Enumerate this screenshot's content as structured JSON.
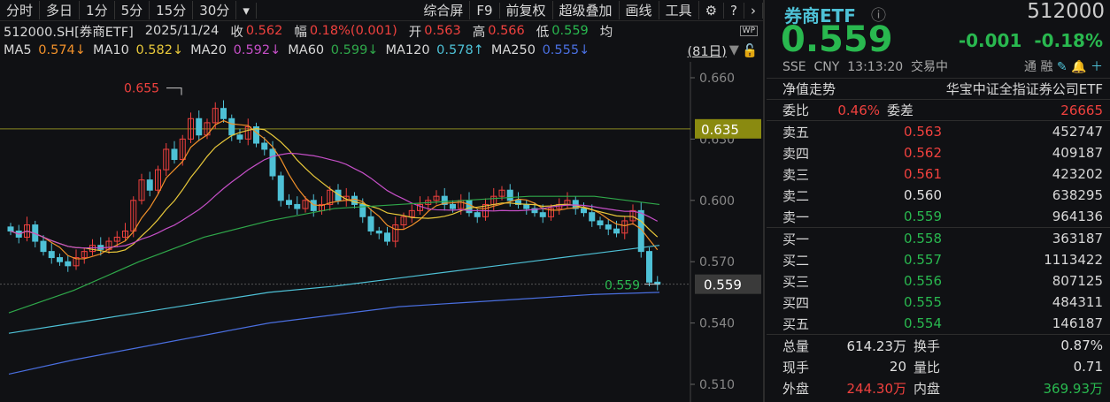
{
  "toolbar": {
    "items": [
      "分时",
      "多日",
      "1分",
      "5分",
      "15分",
      "30分",
      "▾"
    ],
    "right": [
      "综合屏",
      "F9",
      "前复权",
      "超级叠加",
      "画线",
      "工具",
      "⚙",
      "?",
      "›"
    ]
  },
  "info": {
    "code": "512000.SH[券商ETF]",
    "date": "2025/11/24",
    "close_label": "收",
    "close": "0.562",
    "amp_label": "幅",
    "amp": "0.18%(0.001)",
    "open_label": "开",
    "open": "0.563",
    "high_label": "高",
    "high": "0.566",
    "low_label": "低",
    "low": "0.559",
    "avg_label": "均"
  },
  "ma": [
    {
      "label": "MA5",
      "value": "0.574↓",
      "color": "#f0902a"
    },
    {
      "label": "MA10",
      "value": "0.582↓",
      "color": "#e8c83a"
    },
    {
      "label": "MA20",
      "value": "0.592↓",
      "color": "#c54fc7"
    },
    {
      "label": "MA60",
      "value": "0.599↓",
      "color": "#2fa84a"
    },
    {
      "label": "MA120",
      "value": "0.578↑",
      "color": "#4ec1d6"
    },
    {
      "label": "MA250",
      "value": "0.555↓",
      "color": "#4a6fe0"
    }
  ],
  "period": "(81日)",
  "chart": {
    "y_ticks": [
      "0.660",
      "0.630",
      "0.600",
      "0.570",
      "0.540",
      "0.510"
    ],
    "y_tick_values": [
      0.66,
      0.63,
      0.6,
      0.57,
      0.54,
      0.51
    ],
    "hline_label": "0.635",
    "hline_value": 0.635,
    "last_label": "0.559",
    "last_value": 0.559,
    "max_label": "0.655",
    "max_value": 0.655,
    "min_label": "0.559",
    "closes": [
      585,
      582,
      588,
      580,
      575,
      572,
      570,
      568,
      572,
      575,
      578,
      576,
      580,
      582,
      585,
      600,
      610,
      605,
      615,
      625,
      620,
      630,
      640,
      632,
      638,
      645,
      640,
      632,
      630,
      636,
      628,
      625,
      612,
      600,
      598,
      596,
      600,
      595,
      598,
      605,
      600,
      602,
      598,
      592,
      585,
      584,
      580,
      588,
      592,
      595,
      598,
      600,
      602,
      598,
      596,
      600,
      594,
      592,
      598,
      602,
      605,
      600,
      598,
      596,
      594,
      592,
      596,
      598,
      600,
      596,
      594,
      590,
      588,
      586,
      584,
      590,
      595,
      575,
      560,
      559
    ],
    "ma60": [
      545,
      556,
      570,
      582,
      590,
      596,
      598,
      600,
      602,
      602,
      598
    ],
    "ma120": [
      535,
      540,
      545,
      550,
      555,
      558,
      562,
      566,
      570,
      574,
      578
    ],
    "ma250": [
      515,
      522,
      528,
      534,
      540,
      544,
      548,
      550,
      552,
      554,
      555
    ]
  },
  "quote": {
    "name": "券商ETF",
    "code": "512000",
    "price": "0.559",
    "change": "-0.001",
    "change_pct": "-0.18%",
    "exchange": "SSE",
    "currency": "CNY",
    "time": "13:13:20",
    "status": "交易中",
    "tong": "通",
    "rong": "融",
    "nav_label": "净值走势",
    "fund_name": "华宝中证全指证券公司ETF",
    "wb_label": "委比",
    "wb": "0.46%",
    "wc_label": "委差",
    "wc": "26665"
  },
  "asks": [
    {
      "label": "卖五",
      "price": "0.563",
      "vol": "452747",
      "color": "red"
    },
    {
      "label": "卖四",
      "price": "0.562",
      "vol": "409187",
      "color": "red"
    },
    {
      "label": "卖三",
      "price": "0.561",
      "vol": "423202",
      "color": "red"
    },
    {
      "label": "卖二",
      "price": "0.560",
      "vol": "638295",
      "color": "white"
    },
    {
      "label": "卖一",
      "price": "0.559",
      "vol": "964136",
      "color": "green"
    }
  ],
  "bids": [
    {
      "label": "买一",
      "price": "0.558",
      "vol": "363187",
      "color": "green"
    },
    {
      "label": "买二",
      "price": "0.557",
      "vol": "1113422",
      "color": "green"
    },
    {
      "label": "买三",
      "price": "0.556",
      "vol": "807125",
      "color": "green"
    },
    {
      "label": "买四",
      "price": "0.555",
      "vol": "484311",
      "color": "green"
    },
    {
      "label": "买五",
      "price": "0.554",
      "vol": "146187",
      "color": "green"
    }
  ],
  "stats": [
    {
      "l1": "总量",
      "v1": "614.23万",
      "c1": "",
      "l2": "换手",
      "v2": "0.87%",
      "c2": ""
    },
    {
      "l1": "现手",
      "v1": "20",
      "c1": "",
      "l2": "量比",
      "v2": "0.71",
      "c2": ""
    },
    {
      "l1": "外盘",
      "v1": "244.30万",
      "c1": "red",
      "l2": "内盘",
      "v2": "369.93万",
      "c2": "green"
    }
  ]
}
